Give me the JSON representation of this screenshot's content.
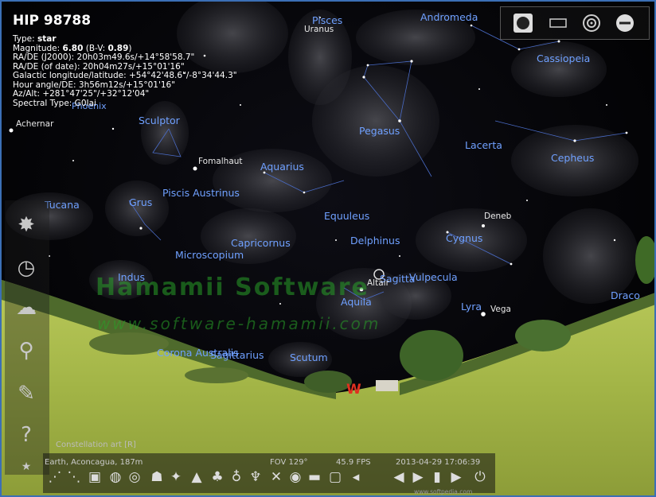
{
  "object_info": {
    "title": "HIP 98788",
    "type_label": "Type:",
    "type_value": "star",
    "magnitude_label": "Magnitude:",
    "magnitude_value": "6.80",
    "bv_label": "(B-V:",
    "bv_value": "0.89",
    "bv_close": ")",
    "radec_j2000": "RA/DE (J2000): 20h03m49.6s/+14°58'58.7\"",
    "radec_date": "RA/DE (of date): 20h04m27s/+15°01'16\"",
    "galactic": "Galactic longitude/latitude: +54°42'48.6\"/-8°34'44.3\"",
    "hour_angle": "Hour angle/DE: 3h56m12s/+15°01'16\"",
    "azalt": "Az/Alt: +281°47'25\"/+32°12'04\"",
    "spectral": "Spectral Type: G0Iai"
  },
  "constellations": [
    "Pisces",
    "Andromeda",
    "Cassiopeia",
    "Sculptor",
    "Pegasus",
    "Lacerta",
    "Cepheus",
    "Aquarius",
    "Piscis Austrinus",
    "Tucana",
    "Grus",
    "Equuleus",
    "Capricornus",
    "Delphinus",
    "Cygnus",
    "Microscopium",
    "Indus",
    "Sagitta",
    "Vulpecula",
    "Aquila",
    "Lyra",
    "Draco",
    "Corona Australis",
    "Sagittarius",
    "Scutum",
    "Phoenix"
  ],
  "stars": [
    "Uranus",
    "Achernar",
    "Fomalhaut",
    "Deneb",
    "Altair",
    "Vega"
  ],
  "watermark": {
    "line1": "Hamamii Software",
    "line2": "www.software-hamamii.com"
  },
  "cardinal": "W",
  "constellation_art_label": "Constellation art  [R]",
  "status": {
    "location": "Earth, Aconcagua, 187m",
    "fov": "FOV 129°",
    "fps": "45.9 FPS",
    "datetime": "2013-04-29   17:06:39"
  },
  "softpedia": "www.softpedia.com",
  "colors": {
    "constellation_label": "#6fa0ff",
    "cardinal": "#e03020",
    "grass": "#a8b84a"
  }
}
